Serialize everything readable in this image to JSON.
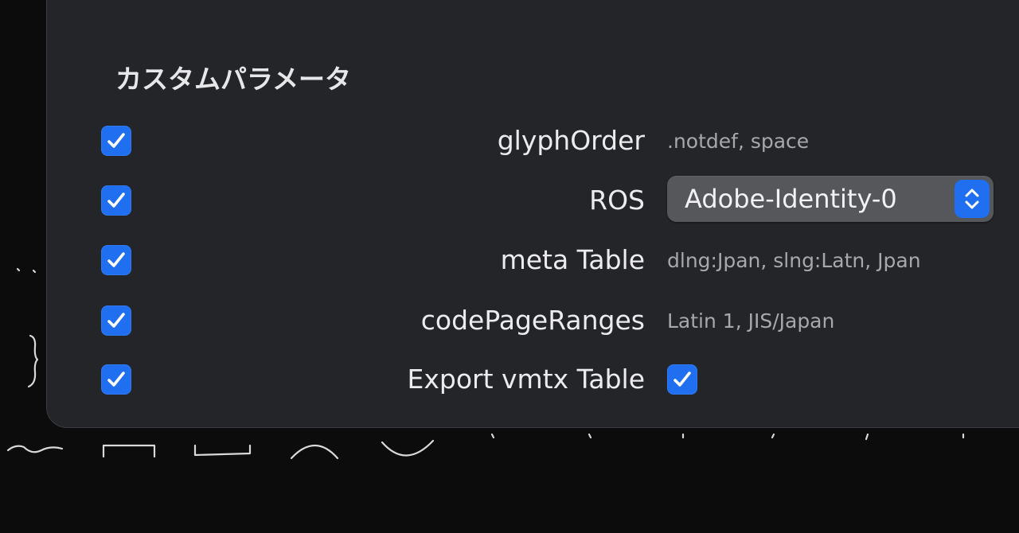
{
  "section": {
    "title": "カスタムパラメータ"
  },
  "params": [
    {
      "enabled": true,
      "name": "glyphOrder",
      "value": ".notdef, space",
      "kind": "text"
    },
    {
      "enabled": true,
      "name": "ROS",
      "value": "Adobe-Identity-0",
      "kind": "popup"
    },
    {
      "enabled": true,
      "name": "meta Table",
      "value": "dlng:Jpan, slng:Latn, Jpan",
      "kind": "text"
    },
    {
      "enabled": true,
      "name": "codePageRanges",
      "value": "Latin 1, JIS/Japan",
      "kind": "text"
    },
    {
      "enabled": true,
      "name": "Export vmtx Table",
      "value_checked": true,
      "kind": "checkbox"
    }
  ],
  "colors": {
    "accent": "#1f6ff0",
    "panel": "#232529",
    "background": "#0c0c0d"
  },
  "icons": {
    "check": "checkmark-icon",
    "stepper": "chevron-up-down-icon"
  }
}
